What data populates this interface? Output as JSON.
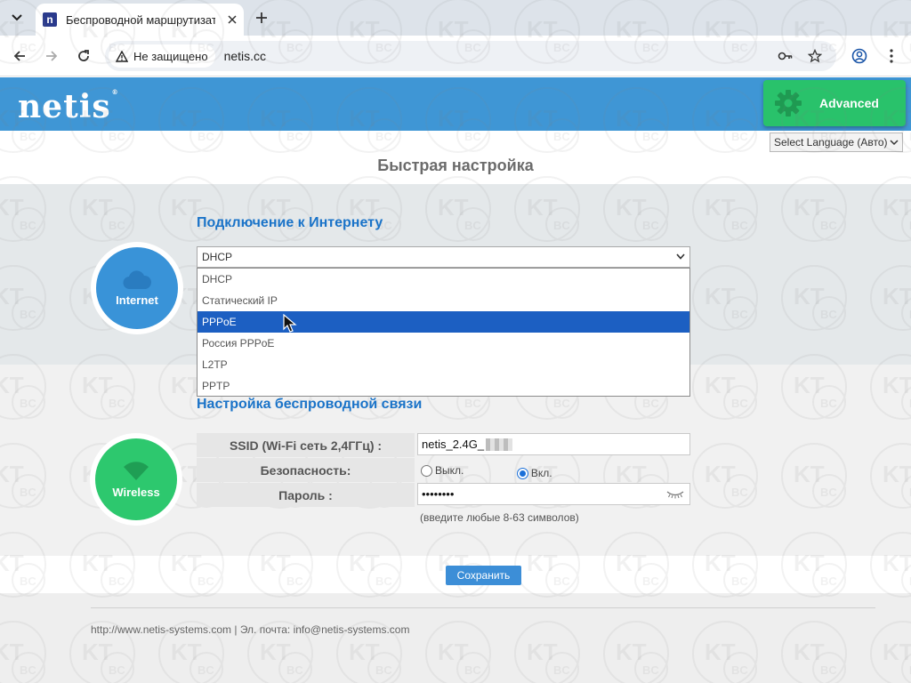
{
  "browser": {
    "tab_title": "Беспроводной маршрутизатор",
    "tab_favicon": "n",
    "security_label": "Не защищено",
    "url": "netis.cc",
    "icons": [
      "tab-menu-icon",
      "close-icon",
      "plus-icon",
      "back-icon",
      "forward-icon",
      "reload-icon",
      "warning-icon",
      "key-icon",
      "star-icon",
      "profile-icon",
      "kebab-menu-icon"
    ]
  },
  "header": {
    "logo": "netis",
    "advanced_label": "Advanced",
    "language_select": "Select Language (Авто)"
  },
  "page_title": "Быстрая настройка",
  "internet": {
    "heading": "Подключение к Интернету",
    "circle_label": "Internet",
    "selected_value": "DHCP",
    "options": [
      "DHCP",
      "Статический IP",
      "PPPoE",
      "Россия PPPoE",
      "L2TP",
      "PPTP"
    ],
    "highlighted_option": "PPPoE"
  },
  "wireless": {
    "heading": "Настройка беспроводной связи",
    "circle_label": "Wireless",
    "ssid_label": "SSID (Wi-Fi сеть 2,4ГГц) :",
    "ssid_value": "netis_2.4G_",
    "security_label": "Безопасность:",
    "security_off": "Выкл.",
    "security_on": "Вкл.",
    "security_selected": "Вкл.",
    "password_label": "Пароль :",
    "password_value": "••••••••",
    "password_hint": "(введите любые 8-63 символов)"
  },
  "save_label": "Сохранить",
  "footer": {
    "text": "http://www.netis-systems.com | Эл. почта: info@netis-systems.com"
  },
  "colors": {
    "banner": "#3f96d5",
    "advanced": "#29c26b",
    "heading": "#1a73c8",
    "internet_circle": "#3993d8",
    "wireless_circle": "#2dc86e",
    "highlight": "#1c5fc2"
  }
}
